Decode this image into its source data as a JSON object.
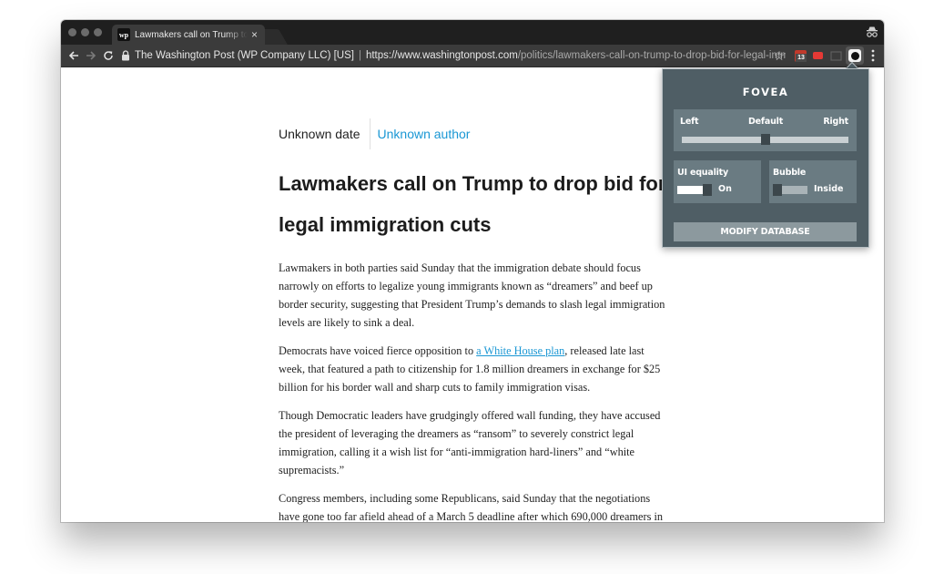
{
  "browser": {
    "tab_title": "Lawmakers call on Trump to drop bid for legal immigration cuts",
    "tab_favicon_text": "wp",
    "site_identity": "The Washington Post (WP Company LLC) [US]",
    "url_host": "https://www.washingtonpost.com",
    "url_path": "/politics/lawmakers-call-on-trump-to-drop-bid-for-legal-immigratio...",
    "extension_badge_count": "13"
  },
  "article": {
    "date": "Unknown date",
    "author": "Unknown author",
    "headline": "Lawmakers call on Trump to drop bid for legal immigration cuts",
    "paragraphs": [
      {
        "text": "Lawmakers in both parties said Sunday that the immigration debate should focus narrowly on efforts to legalize young immigrants known as “dreamers” and beef up border security, suggesting that President Trump’s demands to slash legal immigration levels are likely to sink a deal."
      },
      {
        "before": "Democrats have voiced fierce opposition to ",
        "link": "a White House plan",
        "after": ", released late last week, that featured a path to citizenship for 1.8 million dreamers in exchange for $25 billion for his border wall and sharp cuts to family immigration visas."
      },
      {
        "text": "Though Democratic leaders have grudgingly offered wall funding, they have accused the president of leveraging the dreamers as “ransom” to severely constrict legal immigration, calling it a wish list for “anti-immigration hard-liners” and “white supremacists.”"
      },
      {
        "text": "Congress members, including some Republicans, said Sunday that the negotiations have gone too far afield ahead of a March 5 deadline after which 690,000 dreamers in an Obama-era deferred action program could begin to lose their protections from deportation."
      }
    ]
  },
  "fovea": {
    "title": "FOVEA",
    "bias_left": "Left",
    "bias_default": "Default",
    "bias_right": "Right",
    "bias_value": 0.5,
    "ui_equality_label": "UI equality",
    "ui_equality_state": "On",
    "bubble_label": "Bubble",
    "bubble_state": "Inside",
    "modify_button": "MODIFY DATABASE"
  },
  "colors": {
    "popup_bg": "#4f5e65",
    "panel_bg": "#6a7b82",
    "link": "#1a97d4",
    "chrome_dark": "#3b3b3b"
  },
  "icons": [
    "back-arrow-icon",
    "forward-arrow-icon",
    "reload-icon",
    "lock-icon",
    "star-icon",
    "calendar-extension-icon",
    "youtube-extension-icon",
    "cast-icon",
    "fovea-extension-icon",
    "menu-dots-icon",
    "incognito-icon",
    "close-icon"
  ]
}
